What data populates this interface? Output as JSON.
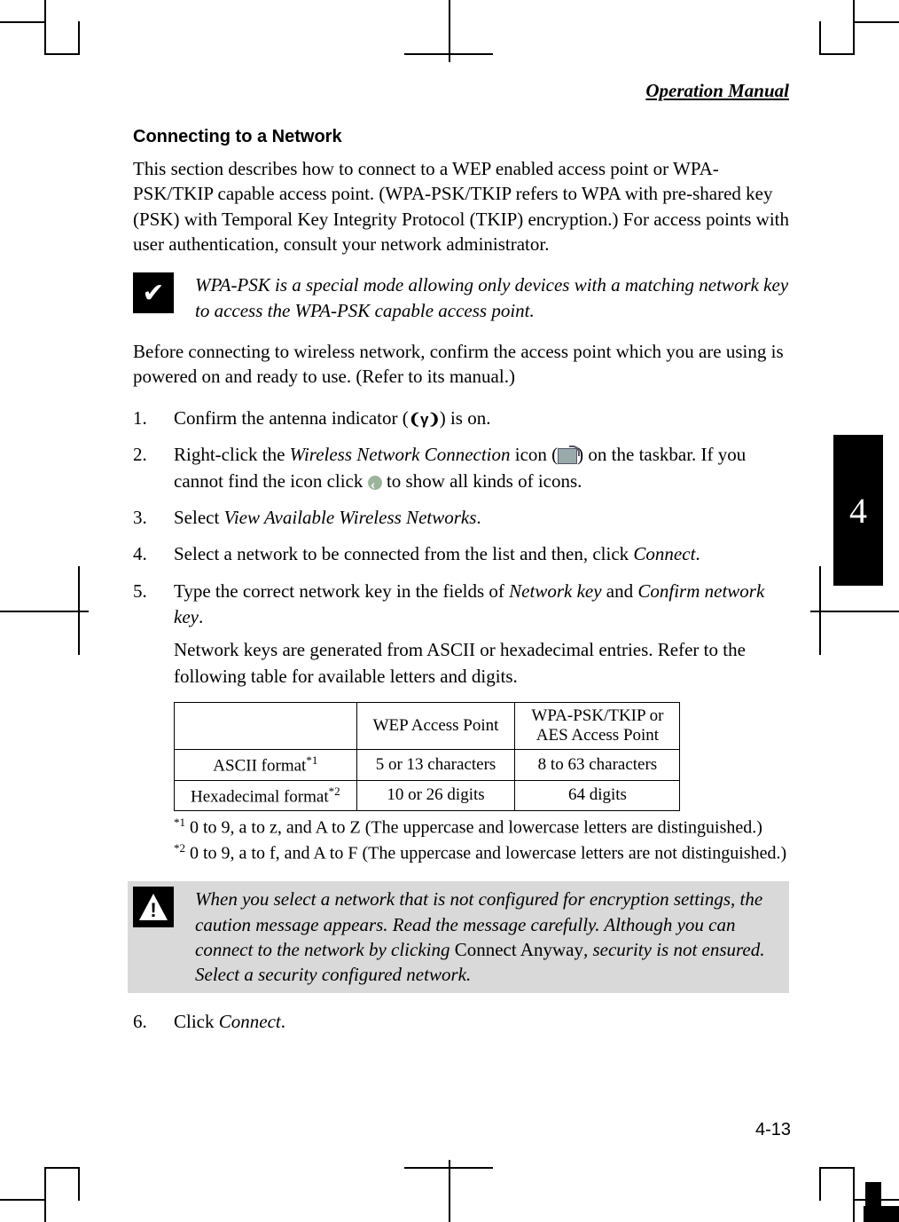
{
  "running_head": "Operation Manual",
  "heading": "Connecting to a Network",
  "intro": "This section describes how to connect to a WEP enabled access point or WPA-PSK/TKIP capable access point. (WPA-PSK/TKIP refers to WPA with pre-shared key (PSK) with Temporal Key Integrity Protocol (TKIP) encryption.) For access points with user authentication, consult your network administrator.",
  "tip": "WPA-PSK is a special mode allowing only devices with a matching network key to access the WPA-PSK capable access point.",
  "before": "Before connecting to wireless network, confirm the access point which you are using is powered on and ready to use. (Refer to its manual.)",
  "steps": {
    "s1_a": "Confirm the antenna indicator (",
    "s1_b": ") is on.",
    "s2_a": "Right-click the ",
    "s2_wnc": "Wireless Network Connection",
    "s2_b": " icon (",
    "s2_c": ") on the taskbar. If you cannot find the icon click ",
    "s2_d": " to show all kinds of icons.",
    "s3_a": "Select ",
    "s3_vawn": "View Available Wireless Networks",
    "s3_b": ".",
    "s4_a": "Select a network to be connected from the list and then, click ",
    "s4_connect": "Connect",
    "s4_b": ".",
    "s5_a": "Type the correct network key in the fields of ",
    "s5_nk": "Network key",
    "s5_and": " and ",
    "s5_cnk": "Confirm network key",
    "s5_b": ".",
    "s5_sub": "Network keys are generated from ASCII or hexadecimal entries. Refer to the following table for available letters and digits.",
    "s6_a": "Click ",
    "s6_connect": "Connect",
    "s6_b": "."
  },
  "table": {
    "h_wep": "WEP Access Point",
    "h_wpa_l1": "WPA-PSK/TKIP or",
    "h_wpa_l2": "AES Access Point",
    "r1_label": "ASCII format",
    "r1_sup": "*1",
    "r1_wep": "5 or 13 characters",
    "r1_wpa": "8 to 63 characters",
    "r2_label": "Hexadecimal format",
    "r2_sup": "*2",
    "r2_wep": "10 or 26 digits",
    "r2_wpa": "64 digits"
  },
  "footnotes": {
    "f1_sup": "*1",
    "f1": " 0 to 9, a to z, and A to Z (The uppercase and lowercase letters are distinguished.)",
    "f2_sup": "*2",
    "f2": " 0 to 9, a to f, and A to F (The uppercase and lowercase letters are not distinguished.)"
  },
  "warning_a": "When you select a network that is not configured for encryption settings, the caution message appears. Read the message carefully. Although you can connect to the network by clicking ",
  "warning_ca": "Connect Anyway",
  "warning_b": ", security is not ensured. Select a security configured network.",
  "side_tab": "4",
  "page_number": "4-13",
  "chart_data": {
    "type": "table",
    "columns": [
      "",
      "WEP Access Point",
      "WPA-PSK/TKIP or AES Access Point"
    ],
    "rows": [
      [
        "ASCII format*1",
        "5 or 13 characters",
        "8 to 63 characters"
      ],
      [
        "Hexadecimal format*2",
        "10 or 26 digits",
        "64 digits"
      ]
    ]
  }
}
